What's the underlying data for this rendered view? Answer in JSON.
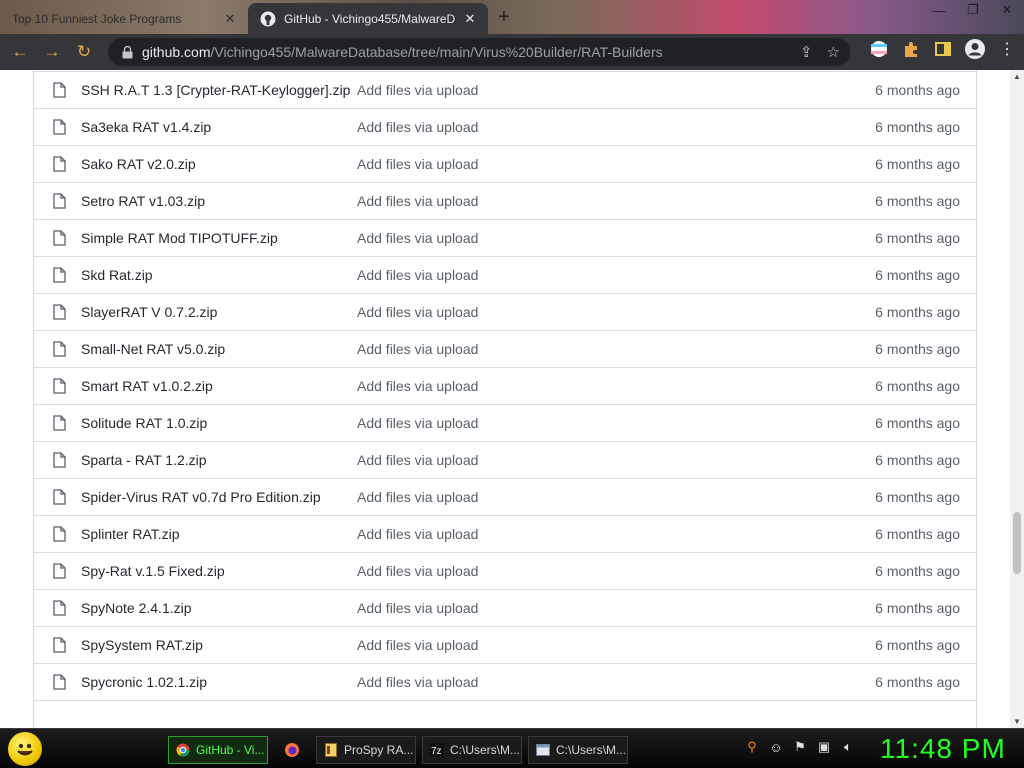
{
  "browser": {
    "tabs": [
      {
        "title": "Top 10 Funniest Joke Programs",
        "active": false
      },
      {
        "title": "GitHub - Vichingo455/MalwareD",
        "active": true
      }
    ],
    "url": {
      "host": "github.com",
      "path": "/Vichingo455/MalwareDatabase/tree/main/Virus%20Builder/RAT-Builders"
    }
  },
  "files": [
    {
      "name": "SSH R.A.T 1.3 [Crypter-RAT-Keylogger].zip",
      "commit": "Add files via upload",
      "age": "6 months ago"
    },
    {
      "name": "Sa3eka RAT v1.4.zip",
      "commit": "Add files via upload",
      "age": "6 months ago"
    },
    {
      "name": "Sako RAT v2.0.zip",
      "commit": "Add files via upload",
      "age": "6 months ago"
    },
    {
      "name": "Setro RAT v1.03.zip",
      "commit": "Add files via upload",
      "age": "6 months ago"
    },
    {
      "name": "Simple RAT Mod TIPOTUFF.zip",
      "commit": "Add files via upload",
      "age": "6 months ago"
    },
    {
      "name": "Skd Rat.zip",
      "commit": "Add files via upload",
      "age": "6 months ago"
    },
    {
      "name": "SlayerRAT V 0.7.2.zip",
      "commit": "Add files via upload",
      "age": "6 months ago"
    },
    {
      "name": "Small-Net RAT v5.0.zip",
      "commit": "Add files via upload",
      "age": "6 months ago"
    },
    {
      "name": "Smart RAT v1.0.2.zip",
      "commit": "Add files via upload",
      "age": "6 months ago"
    },
    {
      "name": "Solitude RAT 1.0.zip",
      "commit": "Add files via upload",
      "age": "6 months ago"
    },
    {
      "name": "Sparta - RAT 1.2.zip",
      "commit": "Add files via upload",
      "age": "6 months ago"
    },
    {
      "name": "Spider-Virus RAT v0.7d Pro Edition.zip",
      "commit": "Add files via upload",
      "age": "6 months ago"
    },
    {
      "name": "Splinter RAT.zip",
      "commit": "Add files via upload",
      "age": "6 months ago"
    },
    {
      "name": "Spy-Rat v.1.5 Fixed.zip",
      "commit": "Add files via upload",
      "age": "6 months ago"
    },
    {
      "name": "SpyNote 2.4.1.zip",
      "commit": "Add files via upload",
      "age": "6 months ago"
    },
    {
      "name": "SpySystem RAT.zip",
      "commit": "Add files via upload",
      "age": "6 months ago"
    },
    {
      "name": "Spycronic 1.02.1.zip",
      "commit": "Add files via upload",
      "age": "6 months ago"
    }
  ],
  "taskbar": {
    "tasks": [
      {
        "label": "GitHub - Vi...",
        "icon": "chrome-icon",
        "active": true
      },
      {
        "label": "ProSpy RA...",
        "icon": "document-icon",
        "active": false
      },
      {
        "label": "C:\\Users\\M...",
        "icon": "7zip-icon",
        "active": false
      },
      {
        "label": "C:\\Users\\M...",
        "icon": "explorer-icon",
        "active": false
      }
    ],
    "clock": "11:48 PM"
  }
}
